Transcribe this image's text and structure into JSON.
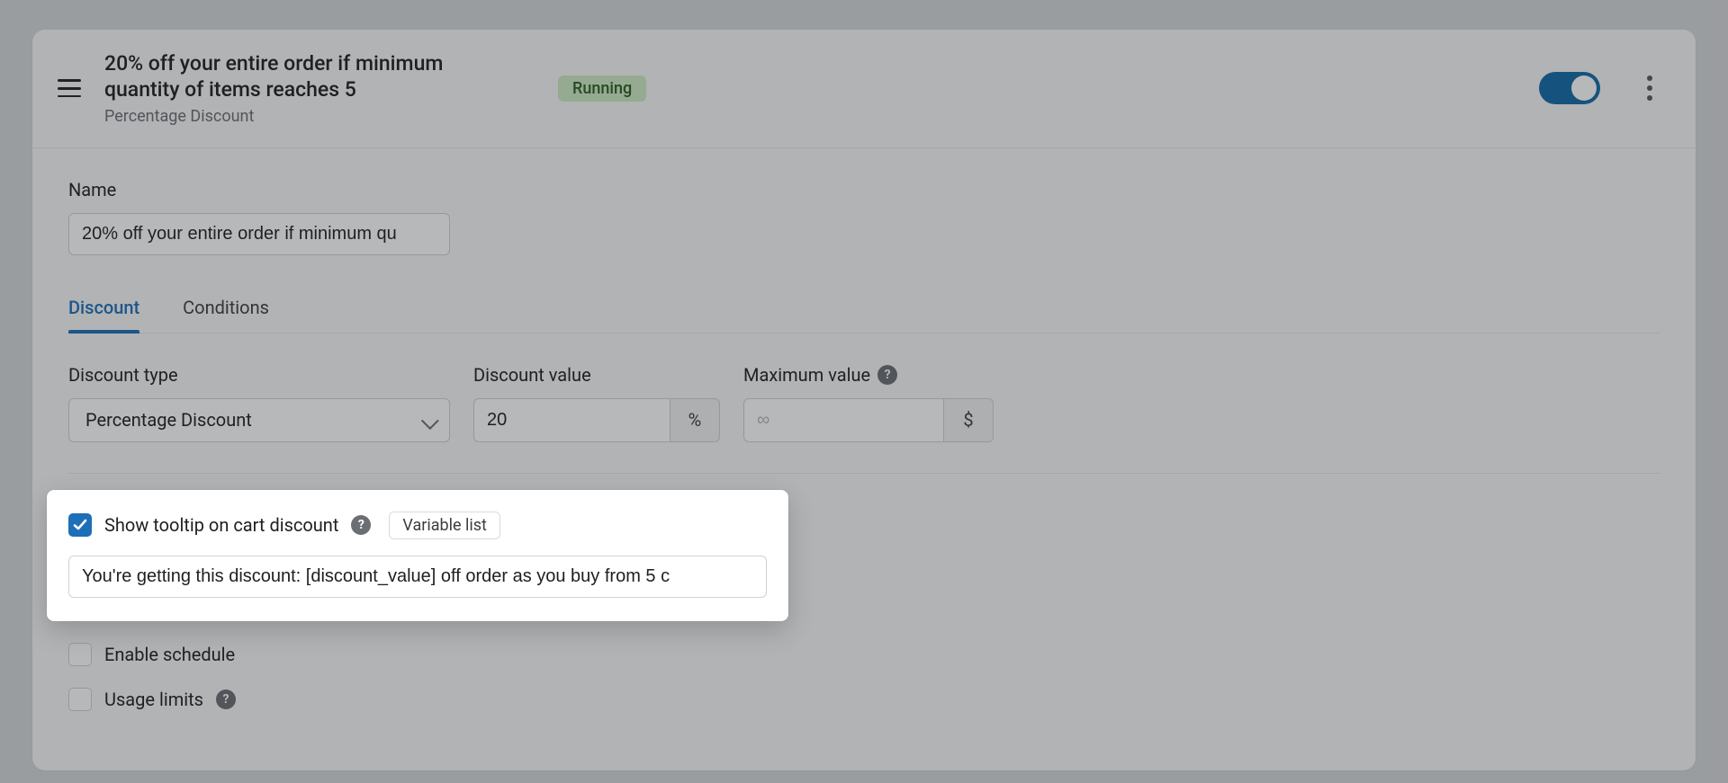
{
  "header": {
    "title": "20% off your entire order if minimum quantity of items reaches 5",
    "subtitle": "Percentage Discount",
    "status": "Running",
    "enabled": true
  },
  "name": {
    "label": "Name",
    "value": "20% off your entire order if minimum qu"
  },
  "tabs": {
    "discount": "Discount",
    "conditions": "Conditions",
    "active": "discount"
  },
  "discount_type": {
    "label": "Discount type",
    "value": "Percentage Discount"
  },
  "discount_value": {
    "label": "Discount value",
    "value": "20",
    "suffix": "%"
  },
  "maximum_value": {
    "label": "Maximum value",
    "value": "",
    "placeholder": "∞",
    "suffix": "$"
  },
  "tooltip_section": {
    "checkbox_label": "Show tooltip on cart discount",
    "variable_list_btn": "Variable list",
    "input_value": "You're getting this discount: [discount_value] off order as you buy from 5 c"
  },
  "schedule": {
    "label": "Enable schedule",
    "checked": false
  },
  "usage_limits": {
    "label": "Usage limits",
    "checked": false
  },
  "glyphs": {
    "help": "?"
  }
}
